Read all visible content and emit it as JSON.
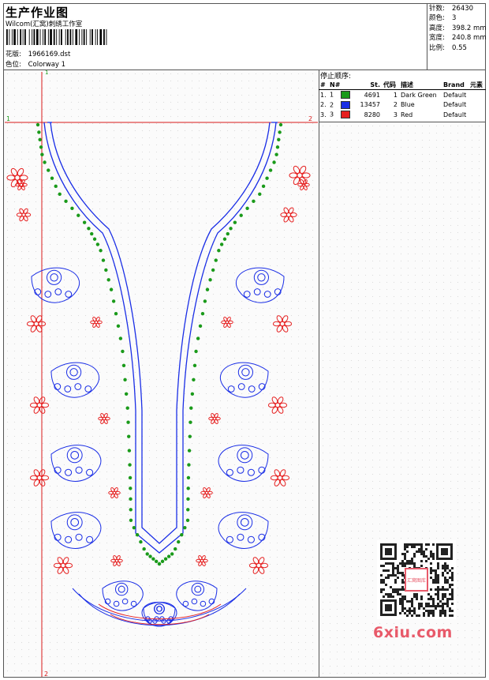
{
  "header": {
    "title": "生产作业图",
    "company": "Wilcom(汇窝)刺绣工作室",
    "design_label": "花版:",
    "design_value": "1966169.dst",
    "colorway_label": "色位:",
    "colorway_value": "Colorway 1"
  },
  "stats": [
    {
      "label": "针数:",
      "value": "26430"
    },
    {
      "label": "颜色:",
      "value": "3"
    },
    {
      "label": "高度:",
      "value": "398.2 mm"
    },
    {
      "label": "宽度:",
      "value": "240.8 mm"
    },
    {
      "label": "比例:",
      "value": "0.55"
    }
  ],
  "stop_sequence": {
    "title": "停止顺序:",
    "columns": [
      "#",
      "N#",
      "St.",
      "代码",
      "描述",
      "Brand",
      "元素"
    ],
    "rows": [
      {
        "num": "1.",
        "n": "1",
        "color": "#1a9a1a",
        "stitches": "4691",
        "code": "1",
        "desc": "Dark Green",
        "brand": "Default"
      },
      {
        "num": "2.",
        "n": "2",
        "color": "#1a2ee6",
        "stitches": "13457",
        "code": "2",
        "desc": "Blue",
        "brand": "Default"
      },
      {
        "num": "3.",
        "n": "3",
        "color": "#e62020",
        "stitches": "8280",
        "code": "3",
        "desc": "Red",
        "brand": "Default"
      }
    ]
  },
  "guides": {
    "v_top": "1",
    "v_bottom": "2",
    "h_left": "1",
    "h_right": "2"
  },
  "watermark": {
    "qr_caption": "汇窝图库",
    "site": "6xiu.com"
  },
  "colors": {
    "green": "#1a9a1a",
    "blue": "#1a2ee6",
    "red": "#e62020",
    "guide": "#d81818"
  }
}
